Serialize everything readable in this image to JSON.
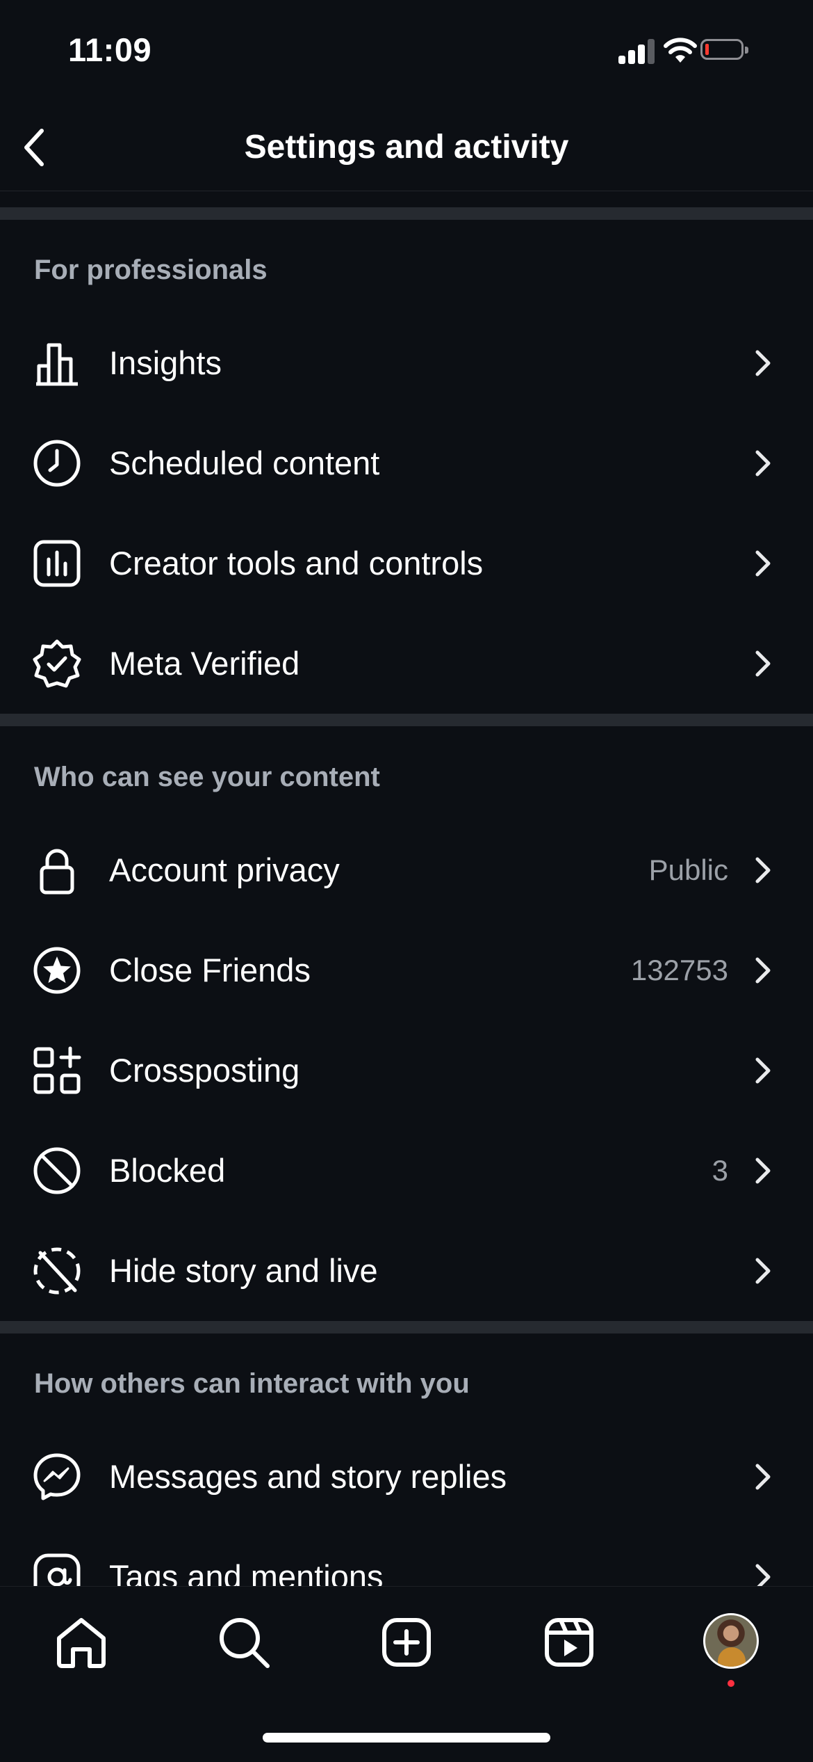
{
  "status_bar": {
    "time": "11:09"
  },
  "header": {
    "title": "Settings and activity"
  },
  "sections": [
    {
      "title": "For professionals",
      "items": [
        {
          "label": "Insights",
          "icon": "bar-chart-icon",
          "value": ""
        },
        {
          "label": "Scheduled content",
          "icon": "clock-icon",
          "value": ""
        },
        {
          "label": "Creator tools and controls",
          "icon": "creator-tools-icon",
          "value": ""
        },
        {
          "label": "Meta Verified",
          "icon": "verified-badge-icon",
          "value": ""
        }
      ]
    },
    {
      "title": "Who can see your content",
      "items": [
        {
          "label": "Account privacy",
          "icon": "lock-icon",
          "value": "Public"
        },
        {
          "label": "Close Friends",
          "icon": "star-circle-icon",
          "value": "132753"
        },
        {
          "label": "Crossposting",
          "icon": "crossposting-icon",
          "value": ""
        },
        {
          "label": "Blocked",
          "icon": "blocked-icon",
          "value": "3"
        },
        {
          "label": "Hide story and live",
          "icon": "hide-story-icon",
          "value": ""
        }
      ]
    },
    {
      "title": "How others can interact with you",
      "items": [
        {
          "label": "Messages and story replies",
          "icon": "messenger-icon",
          "value": ""
        },
        {
          "label": "Tags and mentions",
          "icon": "at-sign-icon",
          "value": ""
        }
      ]
    }
  ],
  "tab_bar": {
    "tabs": [
      "home-icon",
      "search-icon",
      "create-icon",
      "reels-icon",
      "profile-avatar"
    ]
  },
  "colors": {
    "background": "#0c0f14",
    "divider": "#262a30",
    "section_title": "#a8aeb7",
    "value_text": "#9ca1a8",
    "notification_dot": "#ff3040"
  }
}
